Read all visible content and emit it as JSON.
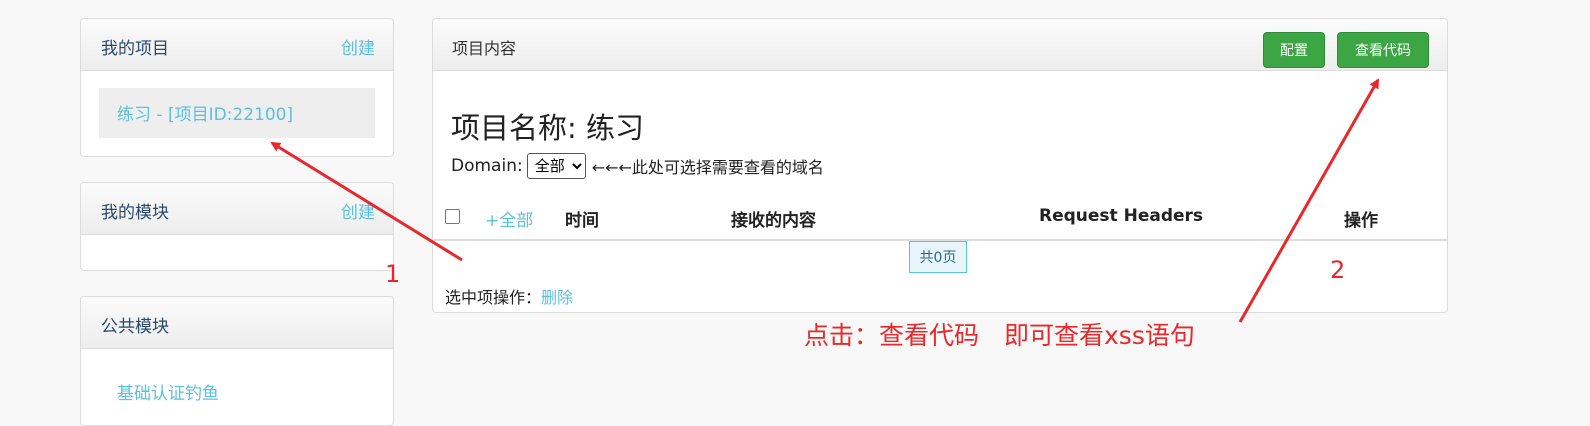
{
  "left": {
    "my_projects": {
      "title": "我的项目",
      "create_label": "创建",
      "items": [
        "练习 - [项目ID:22100]"
      ]
    },
    "my_modules": {
      "title": "我的模块",
      "create_label": "创建"
    },
    "public_modules": {
      "title": "公共模块",
      "items": [
        "基础认证钓鱼"
      ]
    }
  },
  "main": {
    "title": "项目内容",
    "buttons": {
      "config": "配置",
      "view_code": "查看代码"
    },
    "project_name_label": "项目名称: 练习",
    "domain": {
      "label": "Domain:",
      "selected": "全部",
      "hint": "←←←此处可选择需要查看的域名"
    },
    "table": {
      "select_all": "+全部",
      "headers": [
        "时间",
        "接收的内容",
        "Request Headers",
        "操作"
      ]
    },
    "pager": "共0页",
    "selection_ops": {
      "label": "选中项操作：",
      "delete": "删除"
    }
  },
  "annotations": {
    "label_1": "1",
    "label_2": "2",
    "note": "点击：查看代码　即可查看xss语句",
    "color": "#e8282b"
  }
}
